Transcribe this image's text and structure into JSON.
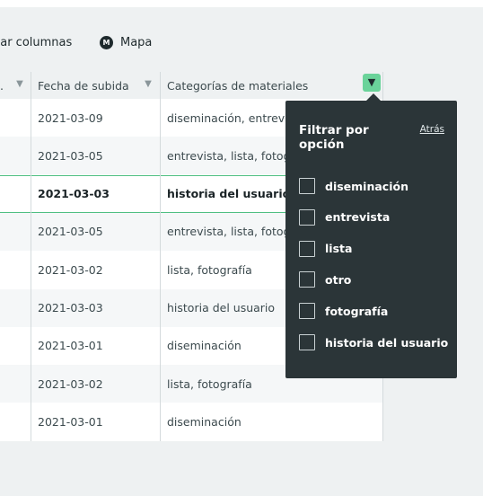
{
  "toolbar": {
    "columns_label": "nar columnas",
    "map_icon_text": "M",
    "map_label": "Mapa"
  },
  "table": {
    "headers": {
      "prev_col": ".",
      "date": "Fecha de subida",
      "categories": "Categorías de materiales"
    },
    "rows": [
      {
        "date": "2021-03-09",
        "categories": "diseminación, entrevista"
      },
      {
        "date": "2021-03-05",
        "categories": "entrevista, lista, fotografía"
      },
      {
        "date": "2021-03-03",
        "categories": "historia del usuario",
        "selected": true
      },
      {
        "date": "2021-03-05",
        "categories": "entrevista, lista, fotografía"
      },
      {
        "date": "2021-03-02",
        "categories": "lista, fotografía"
      },
      {
        "date": "2021-03-03",
        "categories": "historia del usuario"
      },
      {
        "date": "2021-03-01",
        "categories": "diseminación"
      },
      {
        "date": "2021-03-02",
        "categories": "lista, fotografía"
      },
      {
        "date": "2021-03-01",
        "categories": "diseminación"
      }
    ]
  },
  "filter_popover": {
    "title": "Filtrar por opción",
    "back_label": "Atrás",
    "options": [
      {
        "label": "diseminación",
        "checked": false
      },
      {
        "label": "entrevista",
        "checked": false
      },
      {
        "label": "lista",
        "checked": false
      },
      {
        "label": "otro",
        "checked": false
      },
      {
        "label": "fotografía",
        "checked": false
      },
      {
        "label": "historia del usuario",
        "checked": false
      }
    ]
  },
  "colors": {
    "accent": "#6ad39a",
    "selected_row_border": "#4fbf82",
    "popover_bg": "#2b3538"
  }
}
